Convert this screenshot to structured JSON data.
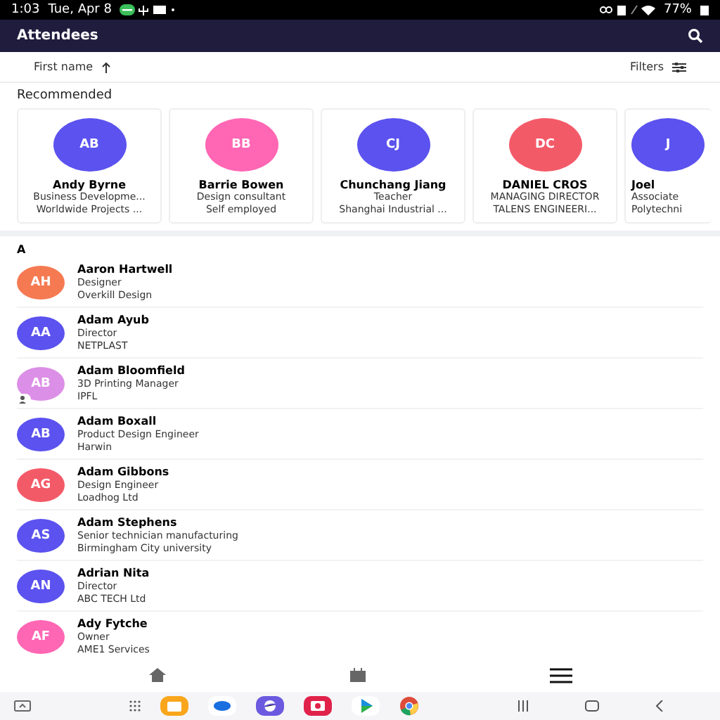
{
  "status_bar": {
    "time": "1:03",
    "date": "Tue, Apr 8",
    "battery": "77%"
  },
  "app_bar": {
    "title": "Attendees"
  },
  "sort_bar": {
    "sort_label": "First name",
    "filters_label": "Filters"
  },
  "recommended": {
    "title": "Recommended",
    "cards": [
      {
        "initials": "AB",
        "name": "Andy Byrne",
        "role": "Business Developme...",
        "company": "Worldwide Projects ...",
        "color": "#5b52ef"
      },
      {
        "initials": "BB",
        "name": "Barrie Bowen",
        "role": "Design consultant",
        "company": "Self employed",
        "color": "#ff66b4"
      },
      {
        "initials": "CJ",
        "name": "Chunchang Jiang",
        "role": "Teacher",
        "company": "Shanghai Industrial ...",
        "color": "#5b52ef"
      },
      {
        "initials": "DC",
        "name": "DANIEL CROS",
        "role": "MANAGING DIRECTOR",
        "company": "TALENS ENGINEERI...",
        "color": "#f35a68"
      },
      {
        "initials": "J",
        "name": "Joel",
        "role": "Associate",
        "company": "Polytechni",
        "color": "#5b52ef"
      }
    ]
  },
  "list": {
    "section": "A",
    "rows": [
      {
        "initials": "AH",
        "name": "Aaron Hartwell",
        "role": "Designer",
        "company": "Overkill Design",
        "color": "#f57a52",
        "contact_badge": false
      },
      {
        "initials": "AA",
        "name": "Adam Ayub",
        "role": "Director",
        "company": "NETPLAST",
        "color": "#5b52ef",
        "contact_badge": false
      },
      {
        "initials": "AB",
        "name": "Adam Bloomfield",
        "role": "3D Printing Manager",
        "company": "IPFL",
        "color": "#dc8fe6",
        "contact_badge": true
      },
      {
        "initials": "AB",
        "name": "Adam Boxall",
        "role": "Product Design Engineer",
        "company": "Harwin",
        "color": "#5b52ef",
        "contact_badge": false
      },
      {
        "initials": "AG",
        "name": "Adam Gibbons",
        "role": "Design Engineer",
        "company": "Loadhog Ltd",
        "color": "#f35a68",
        "contact_badge": false
      },
      {
        "initials": "AS",
        "name": "Adam Stephens",
        "role": "Senior technician manufacturing",
        "company": "Birmingham City university",
        "color": "#5b52ef",
        "contact_badge": false
      },
      {
        "initials": "AN",
        "name": "Adrian Nita",
        "role": "Director",
        "company": "ABC TECH Ltd",
        "color": "#5b52ef",
        "contact_badge": false
      },
      {
        "initials": "AF",
        "name": "Ady Fytche",
        "role": "Owner",
        "company": "AME1 Services",
        "color": "#ff66b4",
        "contact_badge": false
      }
    ]
  }
}
